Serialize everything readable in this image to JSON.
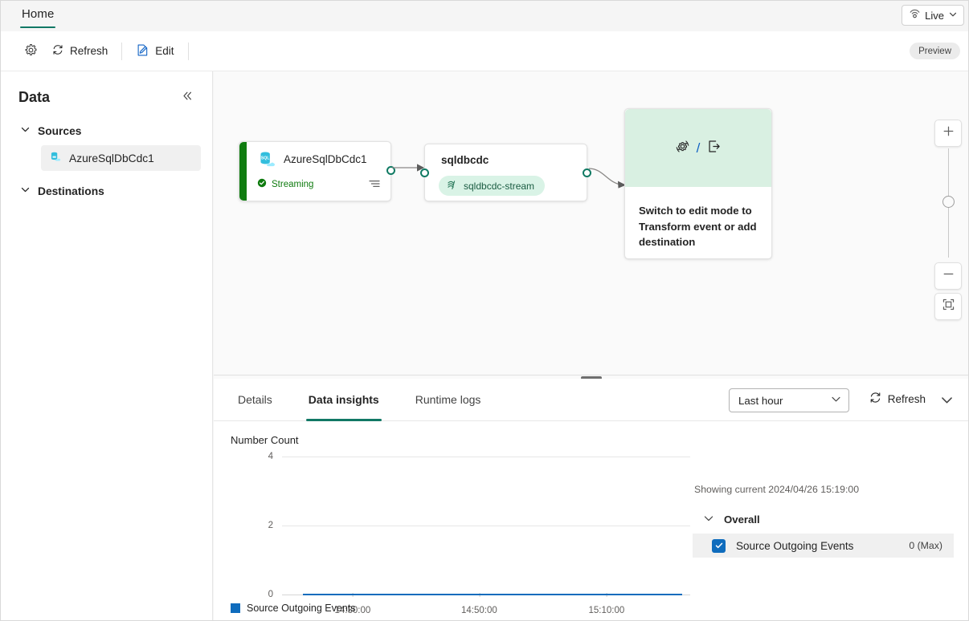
{
  "topbar": {
    "tab_label": "Home",
    "live_label": "Live",
    "live_icon": "broadcast-eye-icon",
    "live_chevron_icon": "chevron-down-icon"
  },
  "commandbar": {
    "settings_icon": "gear-icon",
    "refresh_label": "Refresh",
    "refresh_icon": "refresh-circular-arrow-icon",
    "edit_label": "Edit",
    "edit_icon": "edit-pencil-document-icon",
    "preview_badge": "Preview"
  },
  "sidebar": {
    "title": "Data",
    "collapse_icon": "double-chevron-left-icon",
    "groups": [
      {
        "label": "Sources",
        "chevron_icon": "chevron-down-icon"
      },
      {
        "label": "Destinations",
        "chevron_icon": "chevron-down-icon"
      }
    ],
    "items": [
      {
        "label": "AzureSqlDbCdc1",
        "icon": "azure-sql-database-icon",
        "selected": true
      }
    ]
  },
  "canvas": {
    "source_node": {
      "title": "AzureSqlDbCdc1",
      "icon": "azure-sql-database-icon",
      "status": "Streaming",
      "status_icon": "check-circle-icon",
      "menu_icon": "lines-menu-icon",
      "accent_color": "#107c10"
    },
    "stream_node": {
      "title": "sqldbcdc",
      "pill_label": "sqldbcdc-stream",
      "pill_icon": "eventstream-icon"
    },
    "placeholder_node": {
      "transform_icon": "transform-gear-arrows-icon",
      "separator": "/",
      "destination_icon": "export-arrow-out-icon",
      "text": "Switch to edit mode to Transform event or add destination"
    },
    "zoom_controls": {
      "zoom_in_icon": "plus-icon",
      "zoom_out_icon": "minus-icon",
      "fit_icon": "fit-to-screen-icon",
      "slider_handle_icon": "slider-handle-icon"
    }
  },
  "panel": {
    "tabs": [
      {
        "label": "Details",
        "active": false
      },
      {
        "label": "Data insights",
        "active": true
      },
      {
        "label": "Runtime logs",
        "active": false
      }
    ],
    "time_range": {
      "value": "Last hour",
      "chevron_icon": "chevron-down-icon"
    },
    "refresh_label": "Refresh",
    "refresh_icon": "refresh-circular-arrow-icon",
    "collapse_icon": "chevron-down-icon",
    "showing_text": "Showing current 2024/04/26 15:19:00",
    "overall_group": {
      "label": "Overall",
      "chevron_icon": "chevron-down-icon"
    },
    "metrics": [
      {
        "label": "Source Outgoing Events",
        "value": "0 (Max)",
        "checked": true,
        "color": "#0f6cbd"
      }
    ]
  },
  "chart_data": {
    "type": "line",
    "title": "Number Count",
    "xlabel": "",
    "ylabel": "Number Count",
    "ylim": [
      0,
      4
    ],
    "yticks": [
      "0",
      "2",
      "4"
    ],
    "ytick_values": [
      0,
      2,
      4
    ],
    "xticks": [
      "14:30:00",
      "14:50:00",
      "15:10:00"
    ],
    "xtick_positions": [
      0.173,
      0.483,
      0.795
    ],
    "grid": true,
    "legend_position": "bottom",
    "series": [
      {
        "name": "Source Outgoing Events",
        "color": "#0f6cbd",
        "values": [
          0,
          0,
          0,
          0,
          0,
          0,
          0,
          0,
          0,
          0
        ],
        "max": 0
      }
    ]
  }
}
